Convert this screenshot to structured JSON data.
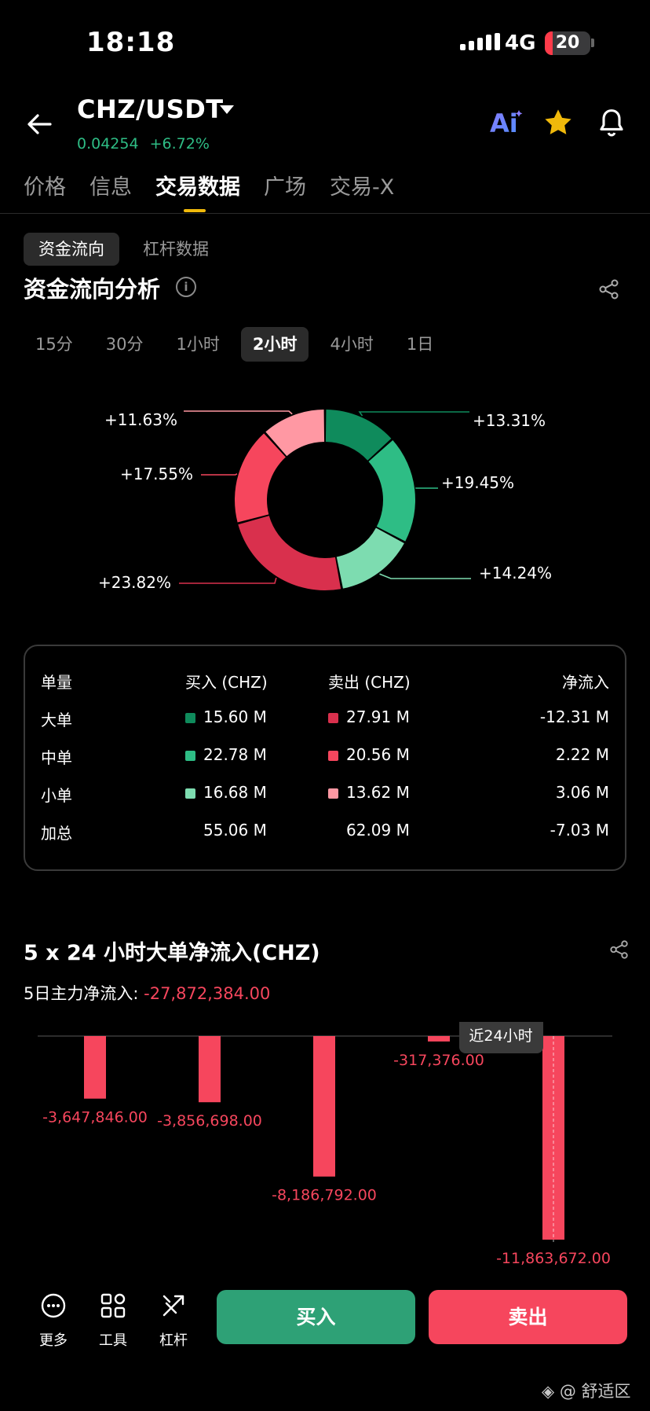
{
  "status": {
    "time": "18:18",
    "network": "4G",
    "battery": "20"
  },
  "header": {
    "pair": "CHZ/USDT",
    "price": "0.04254",
    "change": "+6.72%",
    "ai_label": "Ai"
  },
  "tabs": [
    {
      "label": "价格",
      "active": false
    },
    {
      "label": "信息",
      "active": false
    },
    {
      "label": "交易数据",
      "active": true
    },
    {
      "label": "广场",
      "active": false
    },
    {
      "label": "交易-X",
      "active": false
    }
  ],
  "subtabs": {
    "active": "资金流向",
    "other": "杠杆数据"
  },
  "section_title": "资金流向分析",
  "info_icon": "i",
  "timeframes": [
    {
      "label": "15分",
      "active": false
    },
    {
      "label": "30分",
      "active": false
    },
    {
      "label": "1小时",
      "active": false
    },
    {
      "label": "2小时",
      "active": true
    },
    {
      "label": "4小时",
      "active": false
    },
    {
      "label": "1日",
      "active": false
    }
  ],
  "donut": {
    "segments": [
      {
        "label": "+13.31%",
        "value": 13.31,
        "color": "#0f8b5c"
      },
      {
        "label": "+19.45%",
        "value": 19.45,
        "color": "#2ebd85"
      },
      {
        "label": "+14.24%",
        "value": 14.24,
        "color": "#7ddcb0"
      },
      {
        "label": "+23.82%",
        "value": 23.82,
        "color": "#d9304d"
      },
      {
        "label": "+17.55%",
        "value": 17.55,
        "color": "#f6465d"
      },
      {
        "label": "+11.63%",
        "value": 11.63,
        "color": "#ff98a3"
      }
    ]
  },
  "table": {
    "headers": [
      "单量",
      "买入 (CHZ)",
      "卖出 (CHZ)",
      "净流入"
    ],
    "rows": [
      {
        "name": "大单",
        "buy": "15.60 M",
        "sell": "27.91 M",
        "net": "-12.31 M",
        "buy_color": "#0f8b5c",
        "sell_color": "#d9304d"
      },
      {
        "name": "中单",
        "buy": "22.78 M",
        "sell": "20.56 M",
        "net": "2.22 M",
        "buy_color": "#2ebd85",
        "sell_color": "#f6465d"
      },
      {
        "name": "小单",
        "buy": "16.68 M",
        "sell": "13.62 M",
        "net": "3.06 M",
        "buy_color": "#7ddcb0",
        "sell_color": "#ff98a3"
      }
    ],
    "total": {
      "name": "加总",
      "buy": "55.06 M",
      "sell": "62.09 M",
      "net": "-7.03 M"
    }
  },
  "bar_section": {
    "title": "5 x 24 小时大单净流入(CHZ)",
    "net5_label": "5日主力净流入:",
    "net5_value": "-27,872,384.00",
    "tooltip": "近24小时"
  },
  "chart_data": {
    "type": "bar",
    "title": "5 x 24 小时大单净流入(CHZ)",
    "values": [
      -3647846,
      -3856698,
      -8186792,
      -317376,
      -11863672
    ],
    "value_labels": [
      "-3,647,846.00",
      "-3,856,698.00",
      "-8,186,792.00",
      "-317,376.00",
      "-11,863,672.00"
    ],
    "ylim": [
      -12000000,
      0
    ],
    "color": "#f6465d"
  },
  "bottom_bar": {
    "more": "更多",
    "tools": "工具",
    "leverage": "杠杆",
    "buy": "买入",
    "sell": "卖出"
  },
  "watermark": "@ 舒适区"
}
